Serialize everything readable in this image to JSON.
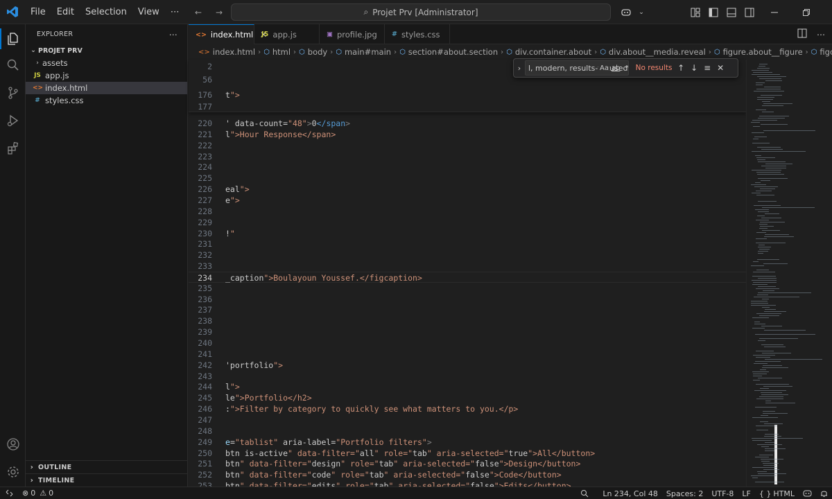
{
  "titlebar": {
    "menu": [
      "File",
      "Edit",
      "Selection",
      "View",
      "⋯"
    ],
    "search_text": "Projet Prv [Administrator]"
  },
  "sidebar": {
    "header": "EXPLORER",
    "project": "PROJET PRV",
    "items": [
      {
        "label": "assets",
        "type": "folder"
      },
      {
        "label": "app.js",
        "type": "js",
        "icon": "JS"
      },
      {
        "label": "index.html",
        "type": "html",
        "icon": "<>"
      },
      {
        "label": "styles.css",
        "type": "css",
        "icon": "#"
      }
    ],
    "outline": "OUTLINE",
    "timeline": "TIMELINE"
  },
  "tabs": [
    {
      "label": "index.html",
      "icon": "<>",
      "active": true
    },
    {
      "label": "app.js",
      "icon": "JS",
      "active": false
    },
    {
      "label": "profile.jpg",
      "icon": "▣",
      "active": false
    },
    {
      "label": "styles.css",
      "icon": "#",
      "active": false
    }
  ],
  "breadcrumbs": [
    "index.html",
    "html",
    "body",
    "main#main",
    "section#about.section",
    "div.container.about",
    "div.about__media.reveal",
    "figure.about__figure",
    "figcaption.about__caption"
  ],
  "find_widget": {
    "query": "l, modern, results-focused.",
    "match_case": "Aa",
    "whole_word": "ab",
    "regex": ".*",
    "no_results": "No results"
  },
  "sticky_lines": [
    {
      "num": "2",
      "code": ""
    },
    {
      "num": "56",
      "code": ""
    },
    {
      "num": "176",
      "code": "t\">"
    },
    {
      "num": "177",
      "code": ""
    }
  ],
  "code_lines": [
    {
      "num": "220",
      "code": "' data-count=\"48\">0</span>"
    },
    {
      "num": "221",
      "code": "l\">Hour Response</span>"
    },
    {
      "num": "222",
      "code": ""
    },
    {
      "num": "223",
      "code": ""
    },
    {
      "num": "224",
      "code": ""
    },
    {
      "num": "225",
      "code": ""
    },
    {
      "num": "226",
      "code": "eal\">"
    },
    {
      "num": "227",
      "code": "e\">"
    },
    {
      "num": "228",
      "code": ""
    },
    {
      "num": "229",
      "code": ""
    },
    {
      "num": "230",
      "code": "!\""
    },
    {
      "num": "231",
      "code": ""
    },
    {
      "num": "232",
      "code": ""
    },
    {
      "num": "233",
      "code": ""
    },
    {
      "num": "234",
      "code": "_caption\">Boulayoun Youssef.</figcaption>",
      "current": true
    },
    {
      "num": "235",
      "code": ""
    },
    {
      "num": "236",
      "code": ""
    },
    {
      "num": "237",
      "code": ""
    },
    {
      "num": "238",
      "code": ""
    },
    {
      "num": "239",
      "code": ""
    },
    {
      "num": "240",
      "code": ""
    },
    {
      "num": "241",
      "code": ""
    },
    {
      "num": "242",
      "code": "'portfolio\">"
    },
    {
      "num": "243",
      "code": ""
    },
    {
      "num": "244",
      "code": "l\">"
    },
    {
      "num": "245",
      "code": "le\">Portfolio</h2>"
    },
    {
      "num": "246",
      "code": ":\">Filter by category to quickly see what matters to you.</p>"
    },
    {
      "num": "247",
      "code": ""
    },
    {
      "num": "248",
      "code": ""
    },
    {
      "num": "249",
      "code": "e=\"tablist\" aria-label=\"Portfolio filters\">"
    },
    {
      "num": "250",
      "code": "btn is-active\" data-filter=\"all\" role=\"tab\" aria-selected=\"true\">All</button>"
    },
    {
      "num": "251",
      "code": "btn\" data-filter=\"design\" role=\"tab\" aria-selected=\"false\">Design</button>"
    },
    {
      "num": "252",
      "code": "btn\" data-filter=\"code\" role=\"tab\" aria-selected=\"false\">Code</button>"
    },
    {
      "num": "253",
      "code": "btn\" data-filter=\"edits\" role=\"tab\" aria-selected=\"false\">Edits</button>"
    }
  ],
  "statusbar": {
    "errors": "0",
    "warnings": "0",
    "position": "Ln 234, Col 48",
    "spaces": "Spaces: 2",
    "encoding": "UTF-8",
    "eol": "LF",
    "language": "HTML"
  },
  "colors": {
    "accent": "#0078d4",
    "html_icon": "#e37933",
    "js_icon": "#cbcb41",
    "css_icon": "#519aba",
    "no_results": "#f48771"
  }
}
